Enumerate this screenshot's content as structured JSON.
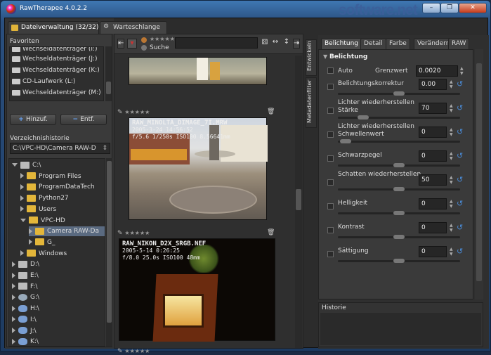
{
  "window": {
    "title": "RawTherapee 4.0.2.2",
    "watermark": "software.net",
    "controls": [
      "–",
      "❐",
      "✕"
    ]
  },
  "left": {
    "tab_file": "Dateiverwaltung (32/32)",
    "tab_queue": "Warteschlange",
    "favorites_label": "Favoriten",
    "favorites": [
      "Wechseldatenträger (I:)",
      "Wechseldatenträger (J:)",
      "Wechseldatenträger (K:)",
      "CD-Laufwerk (L:)",
      "Wechseldatenträger (M:)"
    ],
    "add_label": "Hinzuf.",
    "remove_label": "Entf.",
    "history_label": "Verzeichnishistorie",
    "history_value": "C:\\VPC-HD\\Camera RAW-D",
    "tree": [
      {
        "label": "C:\\",
        "level": 0,
        "type": "drive",
        "open": true
      },
      {
        "label": "Program Files",
        "level": 1,
        "type": "folder"
      },
      {
        "label": "ProgramDataTech",
        "level": 1,
        "type": "folder"
      },
      {
        "label": "Python27",
        "level": 1,
        "type": "folder"
      },
      {
        "label": "Users",
        "level": 1,
        "type": "folder"
      },
      {
        "label": "VPC-HD",
        "level": 1,
        "type": "folder",
        "open": true
      },
      {
        "label": "Camera RAW-Da",
        "level": 2,
        "type": "folder",
        "selected": true
      },
      {
        "label": "G_",
        "level": 2,
        "type": "folder"
      },
      {
        "label": "Windows",
        "level": 1,
        "type": "folder"
      },
      {
        "label": "D:\\",
        "level": 0,
        "type": "drive"
      },
      {
        "label": "E:\\",
        "level": 0,
        "type": "drive"
      },
      {
        "label": "F:\\",
        "level": 0,
        "type": "drive"
      },
      {
        "label": "G:\\",
        "level": 0,
        "type": "cd"
      },
      {
        "label": "H:\\",
        "level": 0,
        "type": "usb"
      },
      {
        "label": "I:\\",
        "level": 0,
        "type": "usb"
      },
      {
        "label": "J:\\",
        "level": 0,
        "type": "usb"
      },
      {
        "label": "K:\\",
        "level": 0,
        "type": "usb"
      }
    ]
  },
  "browser": {
    "search_label": "Suche",
    "photos": [
      {
        "name": "RAW_MINOLTA_DIMAGE_7I.MRW",
        "date": "2005-3-24 14:56:52",
        "exif": "f/5.6 1/250s ISO100 8.56641mm"
      },
      {
        "name": "RAW_NIKON_D2X_SRGB.NEF",
        "date": "2005-5-14 0:26:25",
        "exif": "f/8.0 25.0s ISO100 48mm"
      }
    ],
    "stars": "★★★★★"
  },
  "side_tabs": {
    "develop": "Entwickeln",
    "metadata": "Metadatenfilter"
  },
  "right": {
    "tabs": [
      "Belichtung",
      "Detail",
      "Farbe",
      "Verändern",
      "RAW"
    ],
    "section_title": "Belichtung",
    "auto_label": "Auto",
    "clip_label": "Grenzwert",
    "clip_value": "0.0020",
    "rows": [
      {
        "label": "Belichtungskorrektur",
        "value": "0.00",
        "knob": 0.5
      },
      {
        "label": "Lichter wiederherstellen Stärke",
        "value": "70",
        "knob": 0.18
      },
      {
        "label": "Lichter wiederherstellen Schwellenwert",
        "value": "0",
        "knob": 0.02
      },
      {
        "label": "Schwarzpegel",
        "value": "0",
        "knob": 0.5
      },
      {
        "label": "Schatten wiederherstellen",
        "value": "50",
        "knob": 0.5
      },
      {
        "label": "Helligkeit",
        "value": "0",
        "knob": 0.5
      },
      {
        "label": "Kontrast",
        "value": "0",
        "knob": 0.5
      },
      {
        "label": "Sättigung",
        "value": "0",
        "knob": 0.5
      }
    ],
    "history_label": "Historie"
  }
}
